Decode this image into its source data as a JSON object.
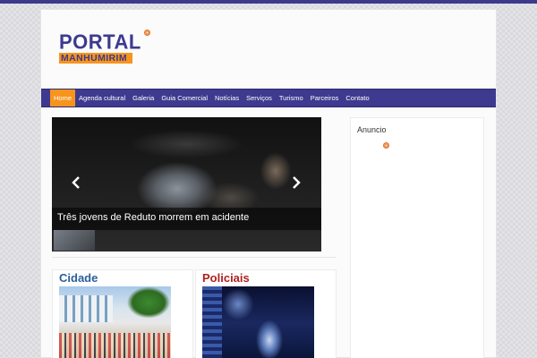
{
  "logo": {
    "top": "PORTAL",
    "bottom": "MANHUMIRIM"
  },
  "nav": {
    "items": [
      {
        "label": "Home",
        "active": true
      },
      {
        "label": "Agenda cultural",
        "active": false
      },
      {
        "label": "Galeria",
        "active": false
      },
      {
        "label": "Guia Comercial",
        "active": false
      },
      {
        "label": "Notícias",
        "active": false
      },
      {
        "label": "Serviços",
        "active": false
      },
      {
        "label": "Turismo",
        "active": false
      },
      {
        "label": "Parceiros",
        "active": false
      },
      {
        "label": "Contato",
        "active": false
      }
    ]
  },
  "slider": {
    "caption": "Três jovens de Reduto morrem em acidente",
    "prev_icon": "chevron-left-icon",
    "next_icon": "chevron-right-icon"
  },
  "sidebar": {
    "title": "Anuncio"
  },
  "sections": [
    {
      "title": "Cidade"
    },
    {
      "title": "Policiais"
    }
  ],
  "colors": {
    "brand_purple": "#3e3a8f",
    "accent_orange": "#f7941d",
    "cidade_title": "#2b5f9c",
    "policiais_title": "#b0201f"
  }
}
